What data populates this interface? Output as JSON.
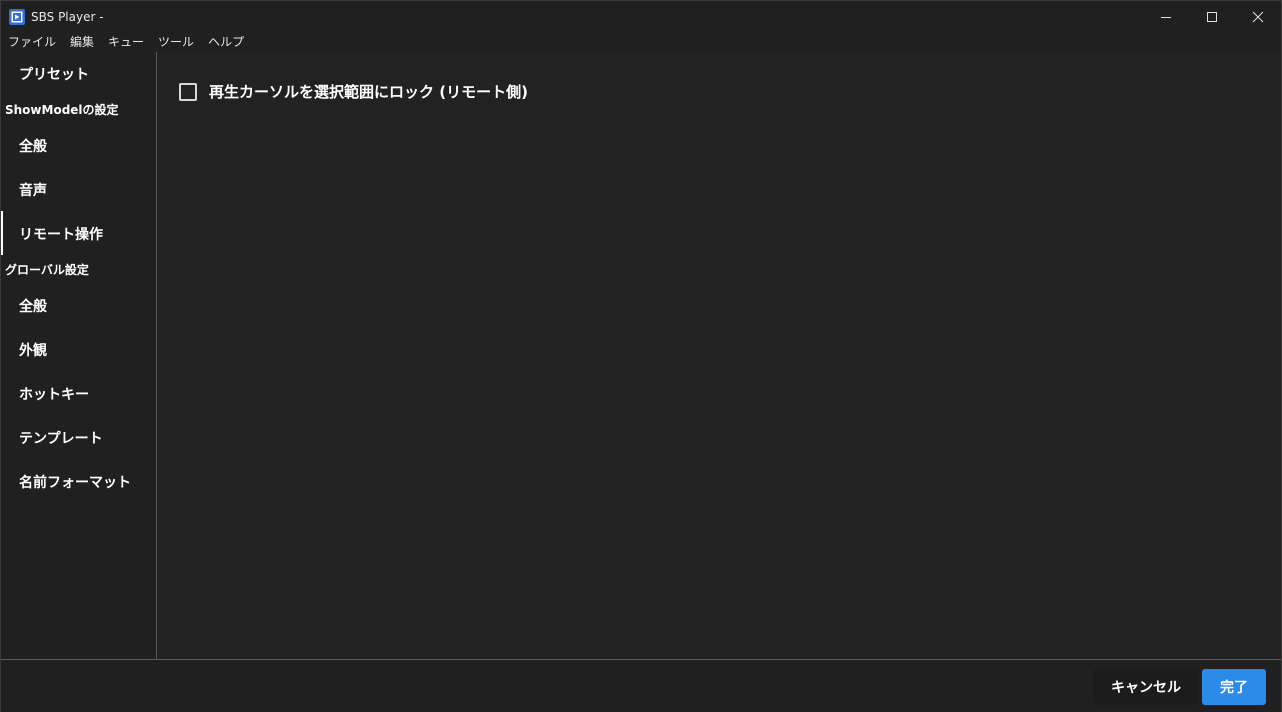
{
  "window": {
    "title": "SBS Player -",
    "app_icon": "film-icon",
    "accent": "#2c8ae8"
  },
  "menu": [
    "ファイル",
    "編集",
    "キュー",
    "ツール",
    "ヘルプ"
  ],
  "sidebar": {
    "preset": "プリセット",
    "showmodel_header": "ShowModelの設定",
    "showmodel_items": [
      "全般",
      "音声",
      "リモート操作"
    ],
    "active_item": "リモート操作",
    "global_header": "グローバル設定",
    "global_items": [
      "全般",
      "外観",
      "ホットキー",
      "テンプレート",
      "名前フォーマット"
    ]
  },
  "main": {
    "checkbox_label": "再生カーソルを選択範囲にロック (リモート側)",
    "checkbox_checked": false
  },
  "footer": {
    "cancel_label": "キャンセル",
    "done_label": "完了"
  }
}
